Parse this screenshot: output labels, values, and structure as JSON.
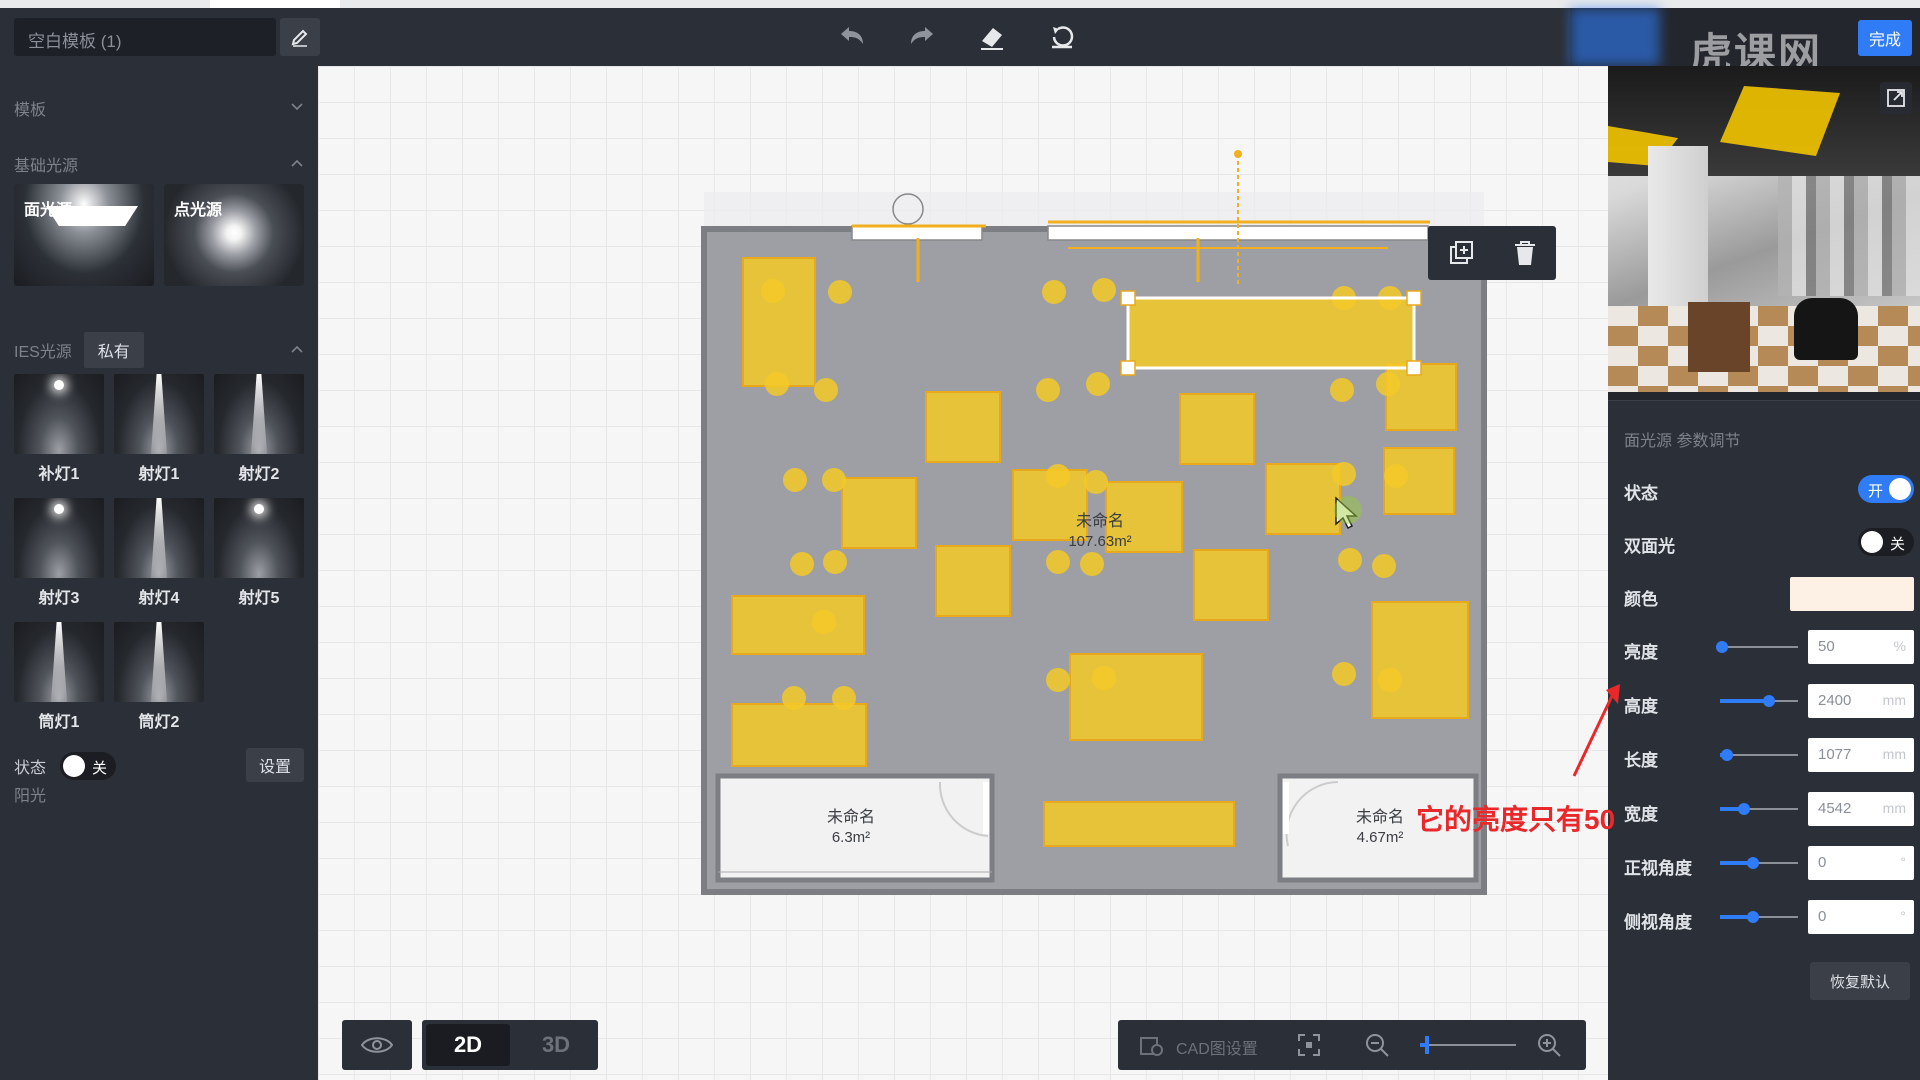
{
  "header": {
    "doc_name": "空白模板 (1)",
    "done_label": "完成",
    "watermark": "虎课网"
  },
  "left_panel": {
    "sections": {
      "template": "模板",
      "basic_lights": "基础光源",
      "ies_lights": "IES光源",
      "sunlight": "阳光"
    },
    "basic_lights": [
      {
        "label": "面光源"
      },
      {
        "label": "点光源"
      }
    ],
    "ies_tab": "私有",
    "ies_items": [
      {
        "label": "补灯1"
      },
      {
        "label": "射灯1"
      },
      {
        "label": "射灯2"
      },
      {
        "label": "射灯3"
      },
      {
        "label": "射灯4"
      },
      {
        "label": "射灯5"
      },
      {
        "label": "筒灯1"
      },
      {
        "label": "筒灯2"
      }
    ],
    "sun": {
      "state_label": "状态",
      "state_value": "关",
      "settings_button": "设置"
    }
  },
  "canvas": {
    "rooms": [
      {
        "name": "未命名",
        "area": "107.63m²"
      },
      {
        "name": "未命名",
        "area": "6.3m²"
      },
      {
        "name": "未命名",
        "area": "4.67m²"
      }
    ],
    "view_2d": "2D",
    "view_3d": "3D",
    "active_view": "2D",
    "cad_label": "CAD图设置",
    "zoom_level": 0.05
  },
  "properties": {
    "title": "面光源 参数调节",
    "status": {
      "label": "状态",
      "value": "开",
      "on": true
    },
    "double_sided": {
      "label": "双面光",
      "value": "关",
      "on": false
    },
    "color": {
      "label": "颜色",
      "value": "#fdf1e6"
    },
    "sliders": [
      {
        "label": "亮度",
        "value": "50",
        "unit": "%",
        "fraction": 0.0
      },
      {
        "label": "高度",
        "value": "2400",
        "unit": "mm",
        "fraction": 0.6
      },
      {
        "label": "长度",
        "value": "1077",
        "unit": "mm",
        "fraction": 0.06
      },
      {
        "label": "宽度",
        "value": "4542",
        "unit": "mm",
        "fraction": 0.28
      },
      {
        "label": "正视角度",
        "value": "0",
        "unit": "°",
        "fraction": 0.4
      },
      {
        "label": "侧视角度",
        "value": "0",
        "unit": "°",
        "fraction": 0.4
      }
    ],
    "reset_button": "恢复默认"
  },
  "annotation": "它的亮度只有50",
  "colors": {
    "accent": "#2f7cf6",
    "light_fill": "#f5c928",
    "annotation": "#e8282b"
  }
}
